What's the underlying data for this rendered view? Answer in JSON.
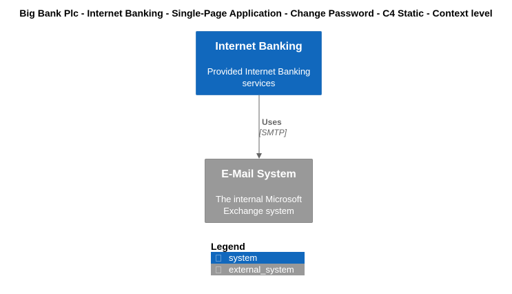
{
  "title": "Big Bank Plc - Internet Banking - Single-Page Application - Change Password - C4 Static - Context level",
  "elements": {
    "internet_banking": {
      "name": "Internet Banking",
      "description": "Provided Internet Banking services",
      "kind": "system",
      "color": "#1168bd"
    },
    "email_system": {
      "name": "E-Mail System",
      "description": "The internal Microsoft Exchange system",
      "kind": "external_system",
      "color": "#999999"
    }
  },
  "relationship": {
    "label": "Uses",
    "technology": "[SMTP]",
    "line_color": "#666666"
  },
  "legend": {
    "title": "Legend",
    "items": [
      {
        "label": "system",
        "color": "#1168bd"
      },
      {
        "label": "external_system",
        "color": "#999999"
      }
    ]
  }
}
